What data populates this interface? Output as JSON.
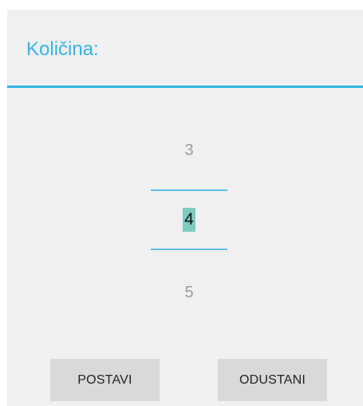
{
  "dialog": {
    "title": "Količina:",
    "accent_color": "#33b5e5"
  },
  "picker": {
    "previous": "3",
    "current": "4",
    "next": "5",
    "selection_color": "#7ecbc0"
  },
  "buttons": {
    "confirm_label": "POSTAVI",
    "cancel_label": "ODUSTANI"
  }
}
